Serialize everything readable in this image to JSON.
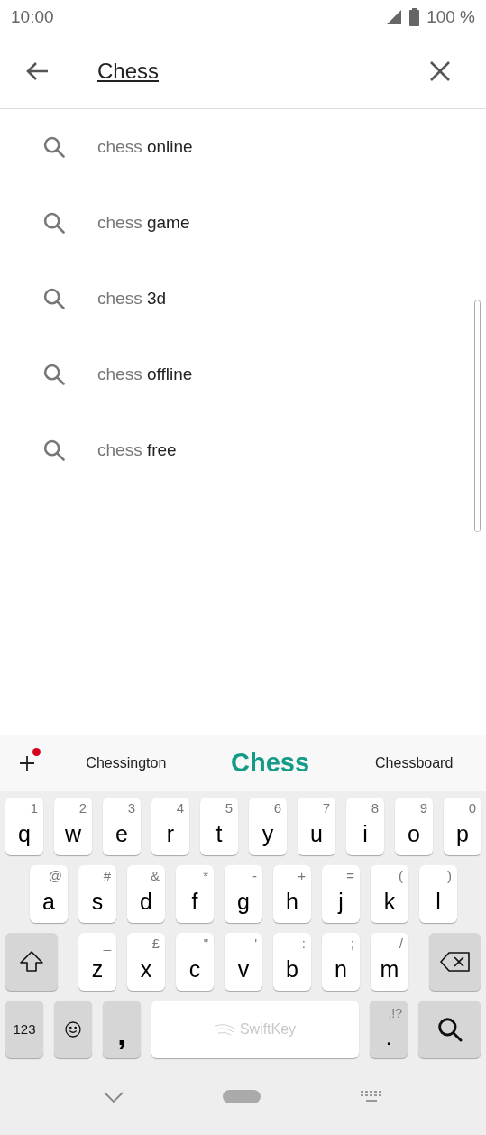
{
  "status_bar": {
    "time": "10:00",
    "battery": "100 %"
  },
  "search": {
    "value": "Chess"
  },
  "suggestions": [
    {
      "typed": "chess",
      "completion": " online"
    },
    {
      "typed": "chess",
      "completion": " game"
    },
    {
      "typed": "chess",
      "completion": " 3d"
    },
    {
      "typed": "chess",
      "completion": " offline"
    },
    {
      "typed": "chess",
      "completion": " free"
    }
  ],
  "keyboard": {
    "predictions": [
      {
        "text": "Chessington",
        "selected": false
      },
      {
        "text": "Chess",
        "selected": true
      },
      {
        "text": "Chessboard",
        "selected": false
      }
    ],
    "number_row": [
      {
        "kind": "letter",
        "main": "q",
        "alt": "1"
      },
      {
        "kind": "letter",
        "main": "w",
        "alt": "2"
      },
      {
        "kind": "letter",
        "main": "e",
        "alt": "3"
      },
      {
        "kind": "letter",
        "main": "r",
        "alt": "4"
      },
      {
        "kind": "letter",
        "main": "t",
        "alt": "5"
      },
      {
        "kind": "letter",
        "main": "y",
        "alt": "6"
      },
      {
        "kind": "letter",
        "main": "u",
        "alt": "7"
      },
      {
        "kind": "letter",
        "main": "i",
        "alt": "8"
      },
      {
        "kind": "letter",
        "main": "o",
        "alt": "9"
      },
      {
        "kind": "letter",
        "main": "p",
        "alt": "0"
      }
    ],
    "home_row": [
      {
        "kind": "letter",
        "main": "a",
        "alt": "@"
      },
      {
        "kind": "letter",
        "main": "s",
        "alt": "#"
      },
      {
        "kind": "letter",
        "main": "d",
        "alt": "&"
      },
      {
        "kind": "letter",
        "main": "f",
        "alt": "*"
      },
      {
        "kind": "letter",
        "main": "g",
        "alt": "-"
      },
      {
        "kind": "letter",
        "main": "h",
        "alt": "+"
      },
      {
        "kind": "letter",
        "main": "j",
        "alt": "="
      },
      {
        "kind": "letter",
        "main": "k",
        "alt": "("
      },
      {
        "kind": "letter",
        "main": "l",
        "alt": ")"
      }
    ],
    "shift_row": [
      {
        "kind": "shift"
      },
      {
        "kind": "letter",
        "main": "z",
        "alt": "_"
      },
      {
        "kind": "letter",
        "main": "x",
        "alt": "£"
      },
      {
        "kind": "letter",
        "main": "c",
        "alt": "\""
      },
      {
        "kind": "letter",
        "main": "v",
        "alt": "'"
      },
      {
        "kind": "letter",
        "main": "b",
        "alt": ":"
      },
      {
        "kind": "letter",
        "main": "n",
        "alt": ";"
      },
      {
        "kind": "letter",
        "main": "m",
        "alt": "/"
      },
      {
        "kind": "backspace"
      }
    ],
    "function_row": [
      {
        "kind": "numbers",
        "main": "123"
      },
      {
        "kind": "emoji"
      },
      {
        "kind": "comma",
        "main": ","
      },
      {
        "kind": "space",
        "main": "SwiftKey"
      },
      {
        "kind": "period",
        "main": ".",
        "alt": ",!?"
      },
      {
        "kind": "search"
      }
    ]
  }
}
